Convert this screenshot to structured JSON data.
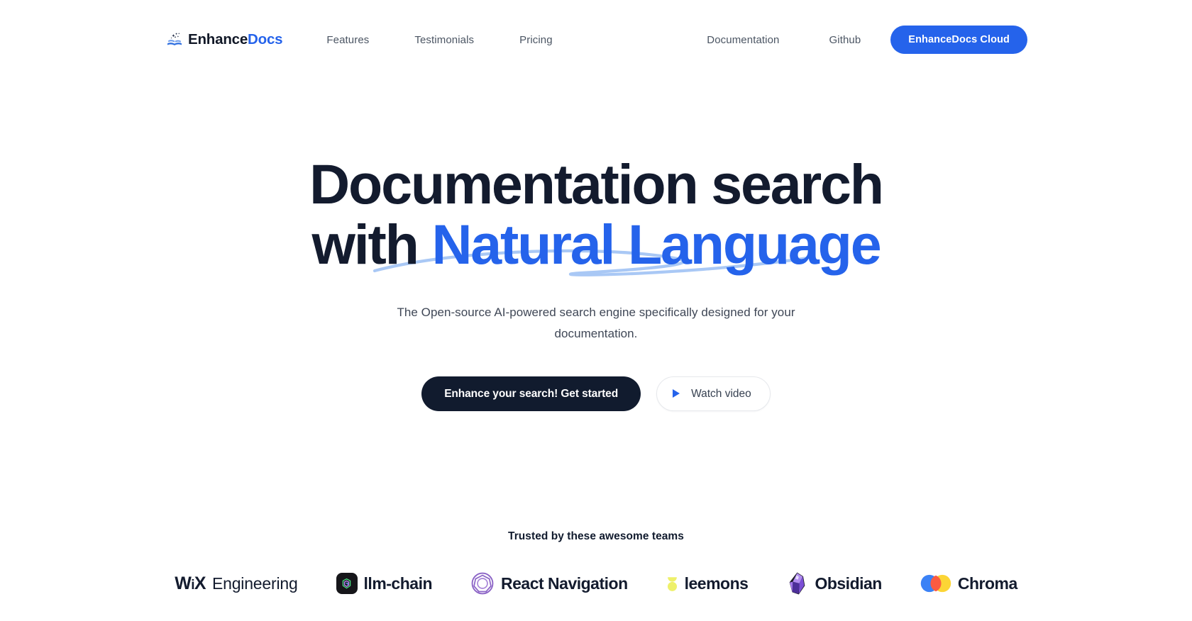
{
  "brand": {
    "name_primary": "Enhance",
    "name_secondary": "Docs",
    "icon": "open-book-sparkles-icon"
  },
  "nav": {
    "left_links": [
      {
        "label": "Features"
      },
      {
        "label": "Testimonials"
      },
      {
        "label": "Pricing"
      }
    ],
    "right_links": [
      {
        "label": "Documentation"
      },
      {
        "label": "Github"
      }
    ],
    "cta": {
      "label": "EnhanceDocs Cloud"
    }
  },
  "hero": {
    "headline_line1": "Documentation search",
    "headline_line2_prefix": "with ",
    "headline_line2_accent": "Natural Language",
    "subtitle": "The Open-source AI-powered search engine specifically designed for your documentation.",
    "primary_cta": "Enhance your search! Get started",
    "secondary_cta": "Watch video",
    "secondary_cta_icon": "play-icon",
    "underline_decoration": "blue-swoosh-underline"
  },
  "trusted": {
    "title": "Trusted by these awesome teams",
    "logos": [
      {
        "name": "WiX Engineering",
        "mark_prefix": "WiX",
        "label": "Engineering",
        "icon": "wix-wordmark-icon"
      },
      {
        "name": "llm-chain",
        "label": "llm-chain",
        "icon": "llm-chain-icon"
      },
      {
        "name": "React Navigation",
        "label": "React Navigation",
        "icon": "react-navigation-icon"
      },
      {
        "name": "leemons",
        "label": "leemons",
        "icon": "leemons-icon"
      },
      {
        "name": "Obsidian",
        "label": "Obsidian",
        "icon": "obsidian-icon"
      },
      {
        "name": "Chroma",
        "label": "Chroma",
        "icon": "chroma-icon"
      }
    ]
  },
  "colors": {
    "brand_blue": "#2563eb",
    "ink": "#131b2e",
    "muted": "#4b5563",
    "swoosh": "#a9c8f5",
    "leemons_yellow": "#eef06a",
    "react_nav_purple": "#8b63c6",
    "chroma_blue": "#3b82f6",
    "chroma_orange": "#fb5b42",
    "chroma_yellow": "#fcd535"
  }
}
